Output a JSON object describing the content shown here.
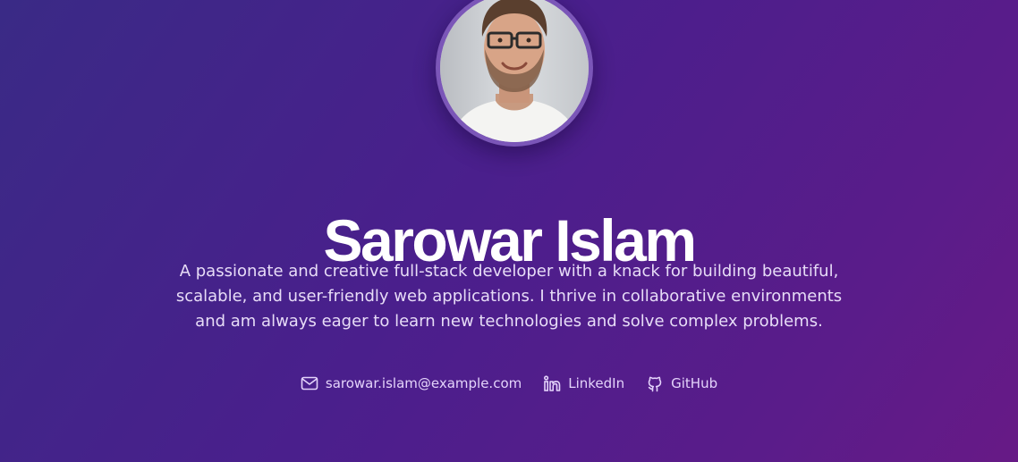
{
  "profile": {
    "name": "Sarowar Islam",
    "bio": "A passionate and creative full-stack developer with a knack for building beautiful, scalable, and user-friendly web applications. I thrive in collaborative environments and am always eager to learn new technologies and solve complex problems.",
    "avatar_icon": "profile-photo"
  },
  "links": [
    {
      "label": "sarowar.islam@example.com",
      "icon": "mail-icon"
    },
    {
      "label": "LinkedIn",
      "icon": "linkedin-icon"
    },
    {
      "label": "GitHub",
      "icon": "github-icon"
    }
  ],
  "colors": {
    "background_start": "#3a2a86",
    "background_end": "#671a86",
    "avatar_ring": "#7b56b8",
    "link_text": "#e4d3fb",
    "bio_text": "#e7dcf7"
  }
}
